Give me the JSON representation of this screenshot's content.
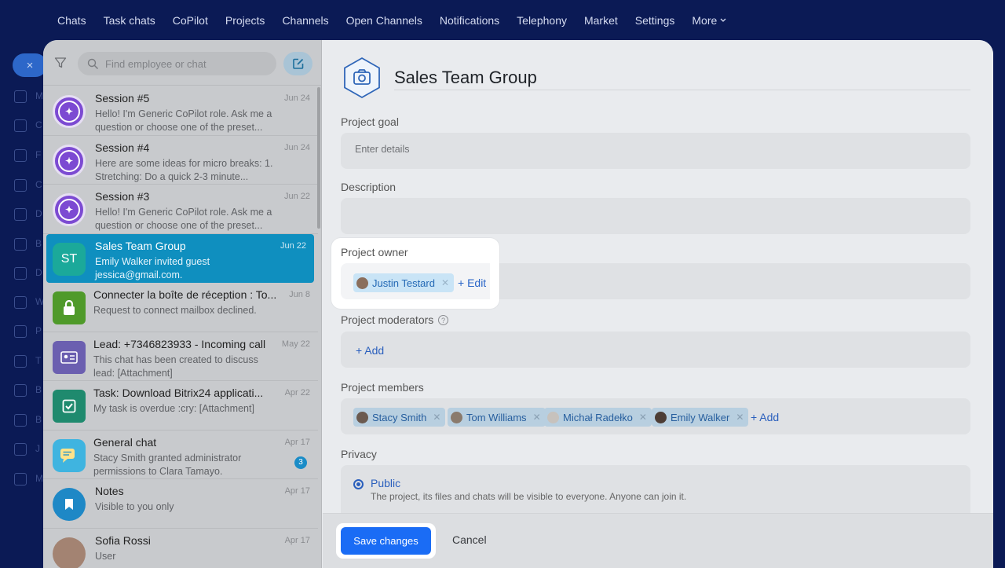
{
  "topnav": {
    "items": [
      "Chats",
      "Task chats",
      "CoPilot",
      "Projects",
      "Channels",
      "Open Channels",
      "Notifications",
      "Telephony",
      "Market",
      "Settings"
    ],
    "more": "More"
  },
  "appbar": {
    "close": "×",
    "letters": [
      "M",
      "C",
      "F",
      "C",
      "D",
      "B",
      "D",
      "W",
      "P",
      "T",
      "B",
      "B",
      "J",
      "M"
    ]
  },
  "search": {
    "placeholder": "Find employee or chat"
  },
  "chats": [
    {
      "title": "Session #5",
      "date": "Jun 24",
      "preview": "Hello! I'm Generic CoPilot role. Ask me a question or choose one of the preset..."
    },
    {
      "title": "Session #4",
      "date": "Jun 24",
      "preview": "Here are some ideas for micro breaks: 1. Stretching: Do a quick 2-3 minute..."
    },
    {
      "title": "Session #3",
      "date": "Jun 22",
      "preview": "Hello! I'm Generic CoPilot role. Ask me a question or choose one of the preset..."
    },
    {
      "title": "Sales Team Group",
      "date": "Jun 22",
      "preview": "Emily Walker invited guest jessica@gmail.com.",
      "initials": "ST"
    },
    {
      "title": "Connecter la boîte de réception : To...",
      "date": "Jun 8",
      "preview": "Request to connect mailbox declined."
    },
    {
      "title": "Lead: +7346823933 - Incoming call",
      "date": "May 22",
      "preview": "This chat has been created to discuss lead: [Attachment]"
    },
    {
      "title": "Task: Download Bitrix24 applicati...",
      "date": "Apr 22",
      "preview": "My task is overdue :cry: [Attachment]"
    },
    {
      "title": "General chat",
      "date": "Apr 17",
      "preview": "Stacy Smith granted administrator permissions to Clara Tamayo.",
      "badge": "3"
    },
    {
      "title": "Notes",
      "date": "Apr 17",
      "preview": "Visible to you only"
    },
    {
      "title": "Sofia Rossi",
      "date": "Apr 17",
      "preview": "User"
    }
  ],
  "project": {
    "title": "Sales Team Group",
    "goal_label": "Project goal",
    "goal_placeholder": "Enter details",
    "description_label": "Description",
    "owner_label": "Project owner",
    "owner_name": "Justin Testard",
    "owner_edit": "+ Edit",
    "moderators_label": "Project moderators",
    "moderators_add": "+ Add",
    "members_label": "Project members",
    "members": [
      "Stacy Smith",
      "Tom Williams",
      "Michał Radełko",
      "Emily Walker"
    ],
    "members_add": "+ Add",
    "privacy_label": "Privacy",
    "privacy_option": "Public",
    "privacy_desc": "The project, its files and chats will be visible to everyone. Anyone can join it."
  },
  "footer": {
    "save": "Save changes",
    "cancel": "Cancel"
  },
  "colors": {
    "accent": "#1a6cf5",
    "active_chat": "#0f8fbf",
    "link": "#2a5fbd"
  }
}
